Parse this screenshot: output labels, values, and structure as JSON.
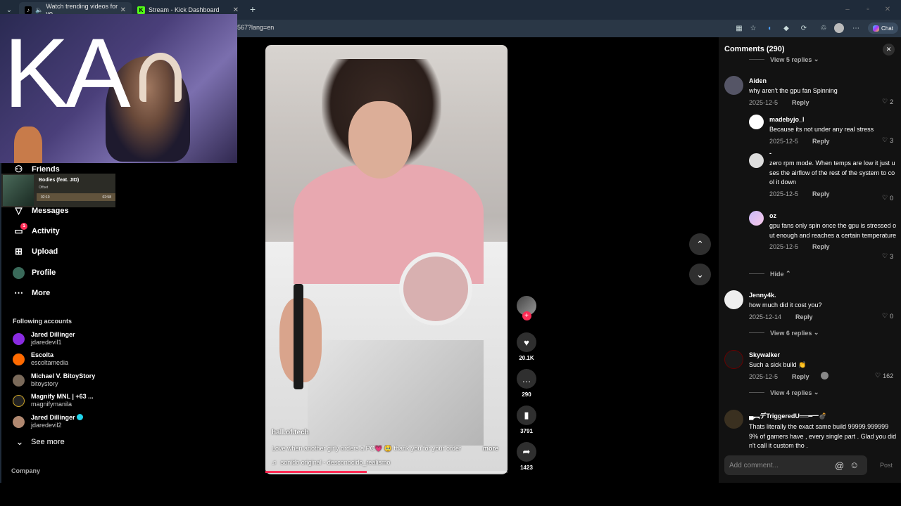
{
  "browser": {
    "tabs": [
      {
        "label": "Watch trending videos for yo",
        "active": true
      },
      {
        "label": "Stream - Kick Dashboard",
        "active": false
      }
    ],
    "url": "567?lang=en",
    "chat_label": "Chat"
  },
  "overlay": {
    "logo_text": "KA"
  },
  "music_widget": {
    "title": "Bodies (feat. JID)",
    "artist": "Offset",
    "elapsed": "02:10",
    "duration": "02:58",
    "progress": 0.73
  },
  "sidebar": {
    "nav": [
      {
        "label": "Friends",
        "icon": "friends-icon"
      },
      {
        "label": "Messages",
        "icon": "messages-icon"
      },
      {
        "label": "Activity",
        "icon": "activity-icon",
        "badge": "1"
      },
      {
        "label": "Upload",
        "icon": "upload-icon"
      },
      {
        "label": "Profile",
        "icon": "profile-icon"
      },
      {
        "label": "More",
        "icon": "more-icon"
      }
    ],
    "following_title": "Following accounts",
    "accounts": [
      {
        "name": "Jared Dillinger",
        "handle": "jdaredevil1",
        "color": "#8a2be2"
      },
      {
        "name": "Escolta",
        "handle": "escoltamedia",
        "color": "#ff6a00"
      },
      {
        "name": "Michael V. BitoyStory",
        "handle": "bitoystory",
        "color": "#7a6a5a"
      },
      {
        "name": "Magnify MNL | +63 ...",
        "handle": "magnifymanila",
        "color": "#222222"
      },
      {
        "name": "Jared Dillinger",
        "handle": "jdaredevil2",
        "color": "#b08870",
        "verified": true
      }
    ],
    "see_more": "See more",
    "company": "Company"
  },
  "video": {
    "author": "hall.of.tech",
    "caption": "Love when another girly orders a PC💗 🥹 thank you for your order",
    "more_label": "more",
    "sound": "sonido original - desconocido_realismo",
    "progress": 0.42,
    "likes": "20.1K",
    "comments": "290",
    "saves": "3791",
    "shares": "1423"
  },
  "comments_panel": {
    "title": "Comments (290)",
    "add_placeholder": "Add comment...",
    "post_label": "Post",
    "top_view_replies": "View 5 replies",
    "reply_label": "Reply",
    "hide_label": "Hide",
    "comments": [
      {
        "user": "Aiden",
        "text": "why aren't the gpu fan Spinning",
        "date": "2025-12-5",
        "likes": "2"
      },
      {
        "user": "madebyjo_l",
        "text": "Because its not under any real stress",
        "date": "2025-12-5",
        "likes": "3"
      },
      {
        "user": "-",
        "text": "zero rpm mode. When temps are low it just uses the airflow of the rest of the system to cool it down",
        "date": "2025-12-5",
        "likes": "0"
      },
      {
        "user": "oz",
        "text": "gpu fans only spin once the gpu is stressed out enough and reaches a certain temperature",
        "date": "2025-12-5",
        "likes": "3"
      },
      {
        "user": "Jenny4k.",
        "text": "how much did it cost you?",
        "date": "2025-12-14",
        "likes": "0",
        "view_replies": "View 6 replies"
      },
      {
        "user": "Skywalker",
        "text": "Such a sick build 👏",
        "date": "2025-12-5",
        "likes": "162",
        "view_replies": "View 4 replies"
      },
      {
        "user": "▄︻デTriggeredU══━一💣",
        "text": "Thats literally the exact same build 99999.9999999% of gamers have , every single part . Glad you didn't call it custom tho .",
        "date": "",
        "likes": ""
      }
    ]
  }
}
